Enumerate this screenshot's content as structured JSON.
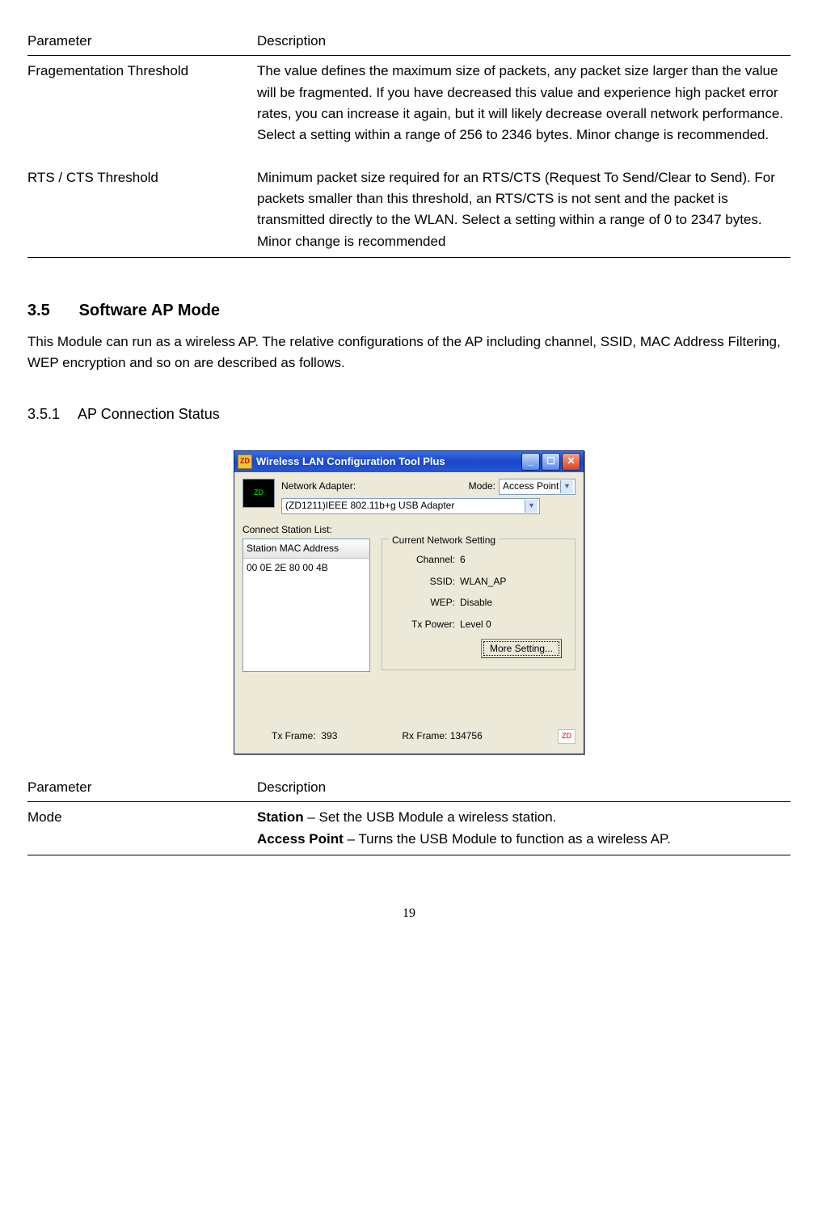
{
  "table1": {
    "header_param": "Parameter",
    "header_desc": "Description",
    "rows": [
      {
        "param": "Fragementation Threshold",
        "desc": "The value defines the maximum size of packets, any packet size larger than the value will be fragmented. If you have decreased this value and experience high packet error rates, you can increase it again, but it will likely decrease overall network performance. Select a setting within a range of 256 to 2346 bytes. Minor change is recommended."
      },
      {
        "param": "RTS / CTS Threshold",
        "desc": "Minimum packet size required for an RTS/CTS (Request To Send/Clear to Send). For packets smaller than this threshold, an RTS/CTS is not sent and the packet is transmitted directly to the WLAN. Select a setting within a range of 0 to 2347 bytes. Minor change is recommended"
      }
    ]
  },
  "section": {
    "num": "3.5",
    "title": "Software AP Mode",
    "intro": "This Module can run as a wireless AP. The relative configurations of the AP including channel, SSID, MAC Address Filtering, WEP encryption and so on are described as follows."
  },
  "subsection": {
    "num": "3.5.1",
    "title": "AP Connection Status"
  },
  "screenshot": {
    "window_title": "Wireless LAN Configuration Tool Plus",
    "zd_text": "ZD",
    "adapter_label": "Network Adapter:",
    "adapter_value": "(ZD1211)IEEE 802.11b+g USB Adapter",
    "mode_label": "Mode:",
    "mode_value": "Access Point",
    "connect_list_label": "Connect Station List:",
    "list_header": "Station MAC Address",
    "list_entry": "00 0E 2E 80 00 4B",
    "group_title": "Current Network Setting",
    "channel_label": "Channel:",
    "channel_value": "6",
    "ssid_label": "SSID:",
    "ssid_value": "WLAN_AP",
    "wep_label": "WEP:",
    "wep_value": "Disable",
    "txpower_label": "Tx Power:",
    "txpower_value": "Level 0",
    "more_button": "More Setting...",
    "txframe_label": "Tx Frame:",
    "txframe_value": "393",
    "rxframe_label": "Rx Frame:",
    "rxframe_value": "134756",
    "corner_icon": "ZD"
  },
  "table2": {
    "header_param": "Parameter",
    "header_desc": "Description",
    "row_param": "Mode",
    "row_desc_bold1": "Station",
    "row_desc_part1": " – Set the USB Module a wireless station.",
    "row_desc_bold2": "Access Point",
    "row_desc_part2": " – Turns the USB Module to function as a wireless AP."
  },
  "page_number": "19"
}
